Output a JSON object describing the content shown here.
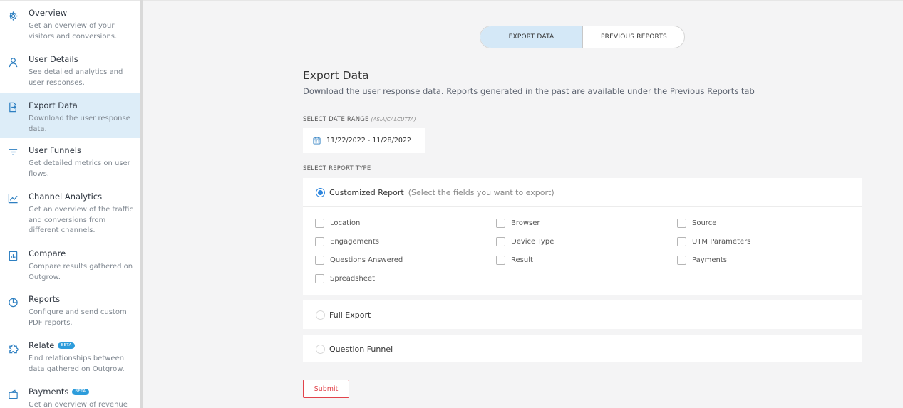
{
  "sidebar": {
    "items": [
      {
        "title": "Overview",
        "desc": "Get an overview of your visitors and conversions.",
        "icon": "gear-icon"
      },
      {
        "title": "User Details",
        "desc": "See detailed analytics and user responses.",
        "icon": "user-icon"
      },
      {
        "title": "Export Data",
        "desc": "Download the user response data.",
        "icon": "export-icon",
        "active": true
      },
      {
        "title": "User Funnels",
        "desc": "Get detailed metrics on user flows.",
        "icon": "filter-icon"
      },
      {
        "title": "Channel Analytics",
        "desc": "Get an overview of the traffic and conversions from different channels.",
        "icon": "line-chart-icon"
      },
      {
        "title": "Compare",
        "desc": "Compare results gathered on Outgrow.",
        "icon": "compare-icon"
      },
      {
        "title": "Reports",
        "desc": "Configure and send custom PDF reports.",
        "icon": "pie-chart-icon"
      },
      {
        "title": "Relate",
        "desc": "Find relationships between data gathered on Outgrow.",
        "icon": "puzzle-icon",
        "badge": "BETA"
      },
      {
        "title": "Payments",
        "desc": "Get an overview of revenue",
        "icon": "payment-icon",
        "badge": "BETA"
      }
    ]
  },
  "tabs": {
    "export": "EXPORT DATA",
    "previous": "PREVIOUS REPORTS"
  },
  "main": {
    "title": "Export Data",
    "subtitle": "Download the user response data. Reports generated in the past are available under the Previous Reports tab",
    "date_label": "SELECT DATE RANGE",
    "date_tz": "(ASIA/CALCUTTA)",
    "date_range": "11/22/2022 - 11/28/2022",
    "report_type_label": "SELECT REPORT TYPE",
    "customized": {
      "label": "Customized Report",
      "hint": "(Select the fields you want to export)"
    },
    "fields": [
      "Location",
      "Browser",
      "Source",
      "Engagements",
      "Device Type",
      "UTM Parameters",
      "Questions Answered",
      "Result",
      "Payments",
      "Spreadsheet"
    ],
    "full_export": "Full Export",
    "question_funnel": "Question Funnel",
    "submit": "Submit"
  },
  "colors": {
    "accent": "#2e86de",
    "active_bg": "#ddedf8",
    "submit": "#e2434b"
  }
}
